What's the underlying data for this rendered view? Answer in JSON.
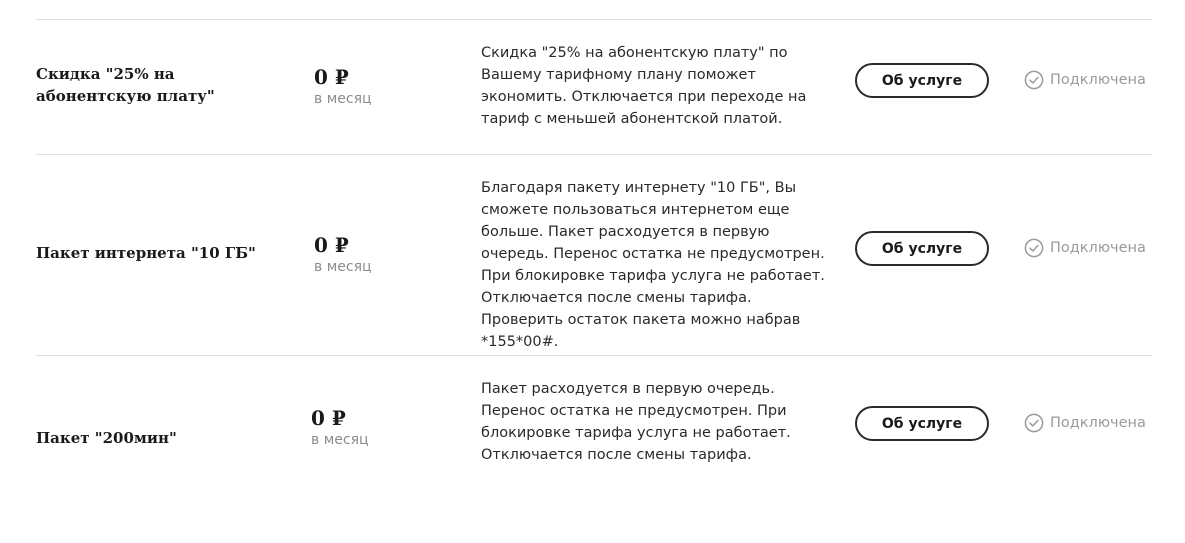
{
  "services": [
    {
      "name": "Скидка \"25% на абонентскую плату\"",
      "price": "0 ₽",
      "period": "в месяц",
      "description": "Скидка \"25% на абонентскую плату\" по Вашему тарифному плану поможет экономить. Отключается при переходе на тариф с меньшей абонентской платой.",
      "button_label": "Об услуге",
      "status": "Подключена",
      "status_icon": "check-circle-icon"
    },
    {
      "name": "Пакет интернета \"10 ГБ\"",
      "price": "0 ₽",
      "period": "в месяц",
      "description": "Благодаря пакету интернету \"10 ГБ\", Вы сможете пользоваться интернетом еще больше. Пакет расходуется в первую очередь. Перенос остатка не предусмотрен. При блокировке тарифа услуга не работает. Отключается после смены тарифа. Проверить остаток пакета можно набрав *155*00#.",
      "button_label": "Об услуге",
      "status": "Подключена",
      "status_icon": "check-circle-icon"
    },
    {
      "name": "Пакет \"200мин\"",
      "price": "0 ₽",
      "period": "в месяц",
      "description": "Пакет расходуется в первую очередь. Перенос остатка не предусмотрен. При блокировке тарифа услуга не работает. Отключается после смены тарифа.",
      "button_label": "Об услуге",
      "status": "Подключена",
      "status_icon": "check-circle-icon"
    }
  ],
  "colors": {
    "text": "#1a1a1a",
    "muted": "#9b9b9b",
    "divider": "#e0e0e0",
    "button_border": "#2a2a2a"
  }
}
